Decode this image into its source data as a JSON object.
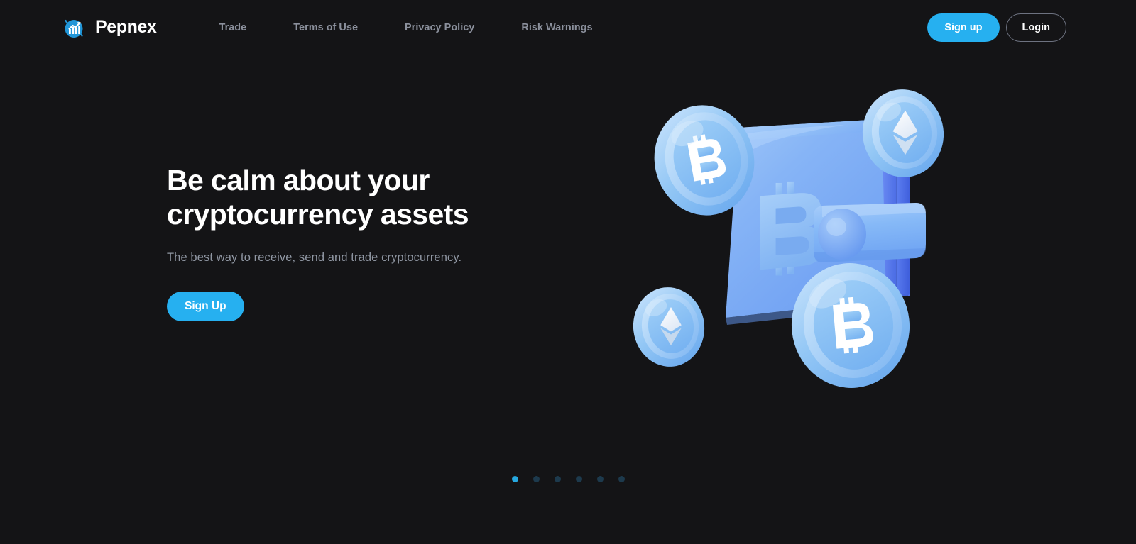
{
  "brand": {
    "name": "Pepnex",
    "logo_icon": "chart-arrow-up-circle-icon"
  },
  "nav": {
    "links": [
      {
        "label": "Trade"
      },
      {
        "label": "Terms of Use"
      },
      {
        "label": "Privacy Policy"
      },
      {
        "label": "Risk Warnings"
      }
    ]
  },
  "auth": {
    "signup_label": "Sign up",
    "login_label": "Login"
  },
  "hero": {
    "title_line1": "Be calm about your",
    "title_line2": "cryptocurrency assets",
    "subtitle": "The best way to receive, send and trade cryptocurrency.",
    "cta_label": "Sign Up",
    "illustration": "crypto-wallet-coins-3d-illustration"
  },
  "carousel": {
    "total_slides": 6,
    "active_slide": 1
  },
  "colors": {
    "accent": "#26b0f0",
    "page_background": "#141416",
    "header_background": "#141416",
    "text_primary": "#ffffff",
    "text_muted": "#8b909c",
    "wallet_blue": "#7fb0f5",
    "wallet_blue_dark": "#4a6fe8",
    "coin_blue": "#8cc4f2"
  }
}
